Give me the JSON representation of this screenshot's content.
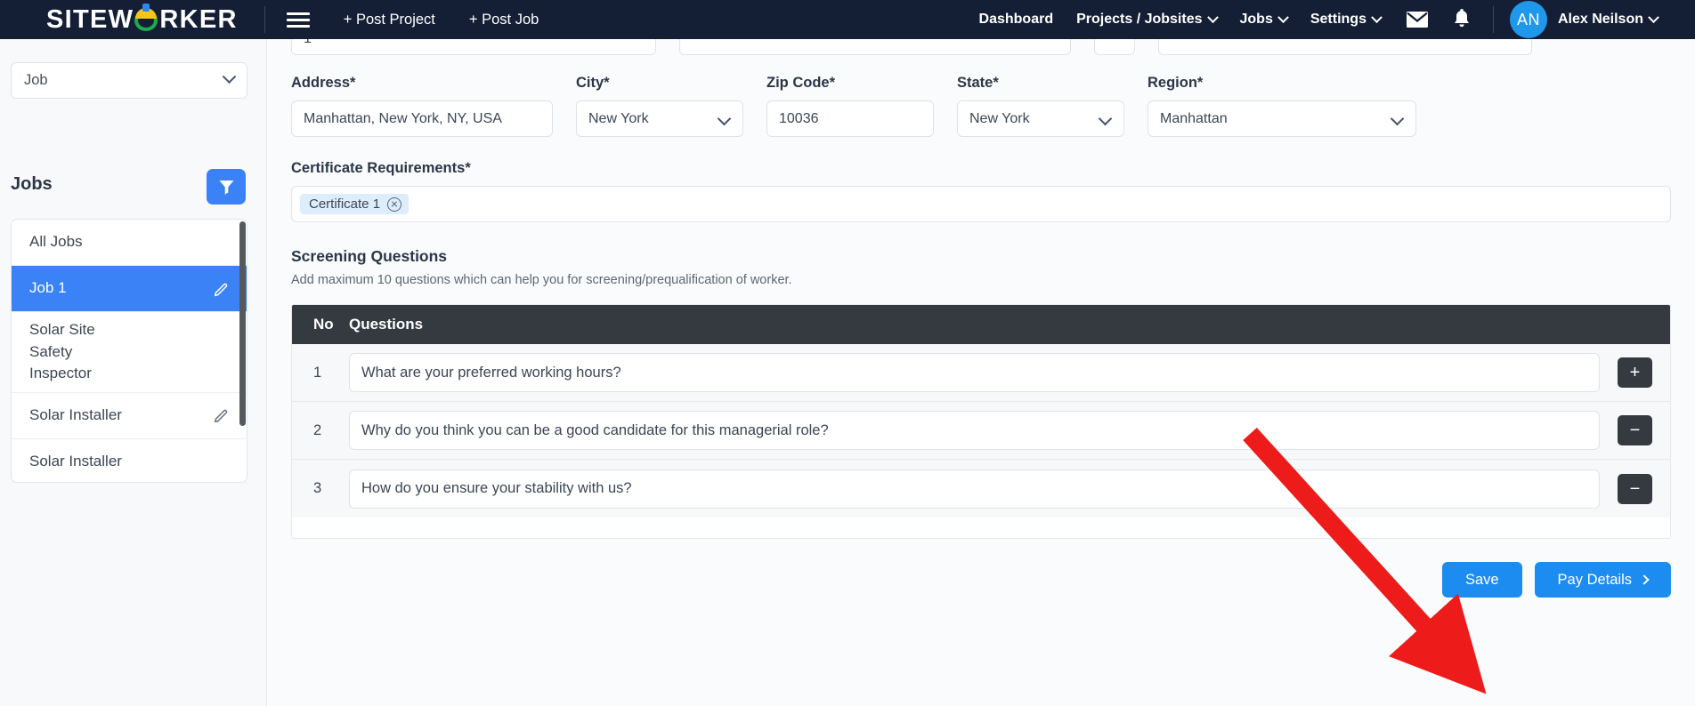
{
  "header": {
    "brand_before": "SITEW",
    "brand_after": "RKER",
    "brand_full": "SITEWORKER",
    "menu_icon": "hamburger-icon",
    "post_project": "+ Post Project",
    "post_job": "+ Post Job",
    "nav": [
      {
        "label": "Dashboard",
        "has_caret": false
      },
      {
        "label": "Projects / Jobsites",
        "has_caret": true
      },
      {
        "label": "Jobs",
        "has_caret": true
      },
      {
        "label": "Settings",
        "has_caret": true
      }
    ],
    "mail_icon": "envelope-icon",
    "bell_icon": "bell-icon",
    "avatar_initials": "AN",
    "user_name": "Alex Neilson"
  },
  "sidebar": {
    "type_select_value": "Job",
    "jobs_heading": "Jobs",
    "filter_icon": "funnel-icon",
    "items": [
      {
        "label": "All Jobs",
        "active": false,
        "editable": false
      },
      {
        "label": "Job 1",
        "active": true,
        "editable": true
      },
      {
        "label": "Solar Site Safety Inspector",
        "active": false,
        "editable": false
      },
      {
        "label": "Solar Installer",
        "active": false,
        "editable": true
      },
      {
        "label": "Solar Installer",
        "active": false,
        "editable": false
      }
    ]
  },
  "form": {
    "address": {
      "label": "Address",
      "required": "*",
      "value": "Manhattan, New York, NY, USA"
    },
    "city": {
      "label": "City",
      "required": "*",
      "value": "New York"
    },
    "zip": {
      "label": "Zip Code",
      "required": "*",
      "value": "10036"
    },
    "state": {
      "label": "State",
      "required": "*",
      "value": "New York"
    },
    "region": {
      "label": "Region",
      "required": "*",
      "value": "Manhattan"
    },
    "certificate": {
      "label": "Certificate Requirements",
      "required": "*",
      "chips": [
        "Certificate 1"
      ]
    }
  },
  "screening": {
    "title": "Screening Questions",
    "subtitle": "Add maximum 10 questions which can help you for screening/prequalification of worker.",
    "columns": [
      "No",
      "Questions"
    ],
    "rows": [
      {
        "no": "1",
        "question": "What are your preferred working hours?",
        "action": "+"
      },
      {
        "no": "2",
        "question": "Why do you think you can be a good candidate for this managerial role?",
        "action": "−"
      },
      {
        "no": "3",
        "question": "How do you ensure your stability with us?",
        "action": "−"
      }
    ]
  },
  "actions": {
    "save": "Save",
    "pay_details": "Pay Details"
  },
  "annotation": {
    "arrow_color": "#ee1b1b",
    "points_to": "save-button"
  },
  "colors": {
    "header_bg": "#141f35",
    "accent_blue": "#3b82f6",
    "button_blue": "#1d8cf0",
    "table_header": "#343a40",
    "chip_bg": "#deedfb"
  }
}
